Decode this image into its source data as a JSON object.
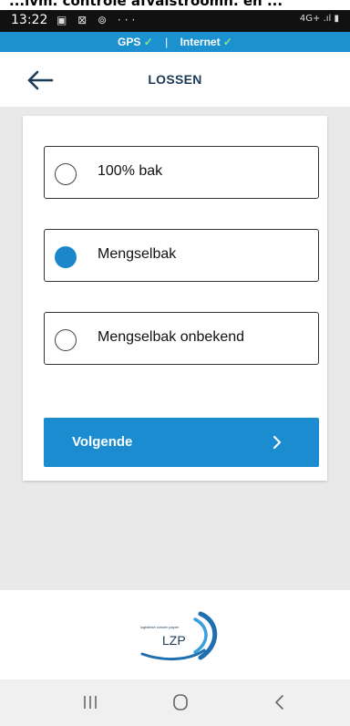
{
  "overlay_text": "...ivm. controle afvalstroomh. en ...",
  "status": {
    "time": "13:22",
    "left_icons": "▣ ⊠ ⊚ ···",
    "right_icons": "4G+ .ıl ▮"
  },
  "connection": {
    "gps_label": "GPS",
    "separator": "|",
    "internet_label": "Internet",
    "check": "✓"
  },
  "header": {
    "title": "LOSSEN"
  },
  "options": [
    {
      "label": "100% bak",
      "selected": false
    },
    {
      "label": "Mengselbak",
      "selected": true
    },
    {
      "label": "Mengselbak onbekend",
      "selected": false
    }
  ],
  "next_button": {
    "label": "Volgende"
  },
  "footer": {
    "logo_text": "LZP",
    "logo_small_text": "logistieke zonder papier"
  },
  "colors": {
    "accent": "#1b91cf",
    "button": "#1a8ccf",
    "radio_selected": "#1b86c9",
    "title": "#1c3a56"
  }
}
